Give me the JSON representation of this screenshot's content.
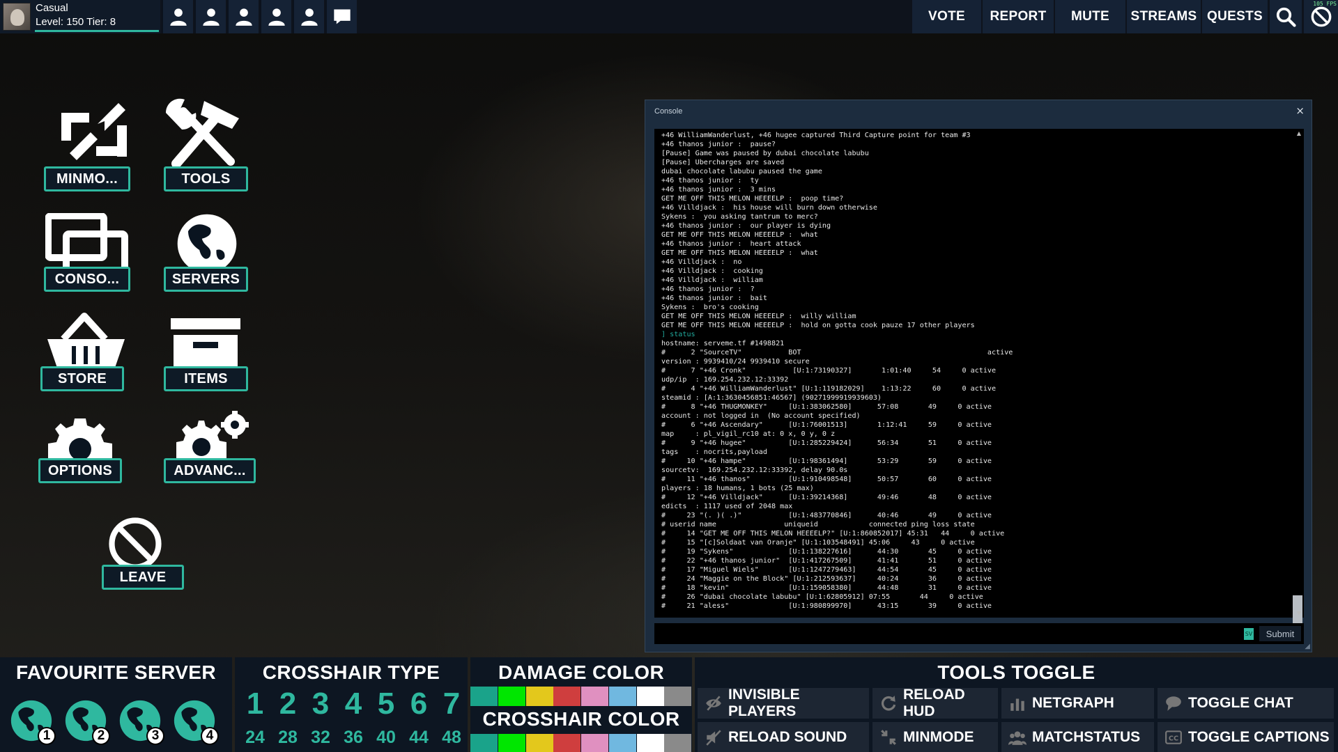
{
  "player": {
    "name": "Casual",
    "level_text": "Level: 150 Tier: 8"
  },
  "party_slots": [
    "person-icon",
    "person-icon",
    "person-icon",
    "person-icon",
    "person-icon",
    "chat-bubble-icon"
  ],
  "nav": {
    "vote": "VOTE",
    "report": "REPORT",
    "mute": "MUTE",
    "streams": "STREAMS",
    "quests": "QUESTS"
  },
  "fps": "105 FPS",
  "menu": {
    "minmode": "MINMO...",
    "tools": "TOOLS",
    "console": "CONSO...",
    "servers": "SERVERS",
    "store": "STORE",
    "items": "ITEMS",
    "options": "OPTIONS",
    "advanced": "ADVANC...",
    "leave": "LEAVE"
  },
  "console": {
    "title": "Console",
    "close": "×",
    "submit": "Submit",
    "sv_badge": "SV",
    "lines": [
      {
        "t": "+46 WilliamWanderlust, +46 hugee captured Third Capture point for team #3",
        "c": 0
      },
      {
        "t": "+46 thanos junior :  pause?",
        "c": 0
      },
      {
        "t": "[Pause] Game was paused by dubai chocolate labubu",
        "c": 0
      },
      {
        "t": "[Pause] Ubercharges are saved",
        "c": 0
      },
      {
        "t": "dubai chocolate labubu paused the game",
        "c": 0
      },
      {
        "t": "+46 thanos junior :  ty",
        "c": 0
      },
      {
        "t": "+46 thanos junior :  3 mins",
        "c": 0
      },
      {
        "t": "GET ME OFF THIS MELON HEEEELP :  poop time?",
        "c": 0
      },
      {
        "t": "+46 Villdjack :  his house will burn down otherwise",
        "c": 0
      },
      {
        "t": "Sykens :  you asking tantrum to merc?",
        "c": 0
      },
      {
        "t": "+46 thanos junior :  our player is dying",
        "c": 0
      },
      {
        "t": "GET ME OFF THIS MELON HEEEELP :  what",
        "c": 0
      },
      {
        "t": "+46 thanos junior :  heart attack",
        "c": 0
      },
      {
        "t": "GET ME OFF THIS MELON HEEEELP :  what",
        "c": 0
      },
      {
        "t": "+46 Villdjack :  no",
        "c": 0
      },
      {
        "t": "+46 Villdjack :  cooking",
        "c": 0
      },
      {
        "t": "+46 Villdjack :  william",
        "c": 0
      },
      {
        "t": "+46 thanos junior :  ?",
        "c": 0
      },
      {
        "t": "+46 thanos junior :  bait",
        "c": 0
      },
      {
        "t": "Sykens :  bro's cooking",
        "c": 0
      },
      {
        "t": "GET ME OFF THIS MELON HEEEELP :  willy william",
        "c": 0
      },
      {
        "t": "GET ME OFF THIS MELON HEEEELP :  hold on gotta cook pauze 17 other players",
        "c": 0
      },
      {
        "t": "] status",
        "c": 1
      },
      {
        "t": "hostname: serveme.tf #1498821",
        "c": 0
      },
      {
        "t": "#      2 \"SourceTV\"           BOT                                            active",
        "c": 0
      },
      {
        "t": "version : 9939410/24 9939410 secure",
        "c": 0
      },
      {
        "t": "#      7 \"+46 Cronk\"           [U:1:73190327]       1:01:40     54     0 active",
        "c": 0
      },
      {
        "t": "udp/ip  : 169.254.232.12:33392",
        "c": 0
      },
      {
        "t": "#      4 \"+46 WilliamWanderlust\" [U:1:119182029]    1:13:22     60     0 active",
        "c": 0
      },
      {
        "t": "steamid : [A:1:3630456851:46567] (90271999919939603)",
        "c": 0
      },
      {
        "t": "#      8 \"+46 THUGMONKEY\"     [U:1:383062580]      57:08       49     0 active",
        "c": 0
      },
      {
        "t": "account : not logged in  (No account specified)",
        "c": 0
      },
      {
        "t": "#      6 \"+46 Ascendary\"      [U:1:76001513]       1:12:41     59     0 active",
        "c": 0
      },
      {
        "t": "map     : pl_vigil_rc10 at: 0 x, 0 y, 0 z",
        "c": 0
      },
      {
        "t": "#      9 \"+46 hugee\"          [U:1:285229424]      56:34       51     0 active",
        "c": 0
      },
      {
        "t": "tags    : nocrits,payload",
        "c": 0
      },
      {
        "t": "#     10 \"+46 hampe\"          [U:1:98361494]       53:29       59     0 active",
        "c": 0
      },
      {
        "t": "sourcetv:  169.254.232.12:33392, delay 90.0s",
        "c": 0
      },
      {
        "t": "#     11 \"+46 thanos\"         [U:1:910498548]      50:57       60     0 active",
        "c": 0
      },
      {
        "t": "players : 18 humans, 1 bots (25 max)",
        "c": 0
      },
      {
        "t": "#     12 \"+46 Villdjack\"      [U:1:39214368]       49:46       48     0 active",
        "c": 0
      },
      {
        "t": "edicts  : 1117 used of 2048 max",
        "c": 0
      },
      {
        "t": "#     23 \"(. )( .)\"           [U:1:483770846]      40:46       49     0 active",
        "c": 0
      },
      {
        "t": "# userid name                uniqueid            connected ping loss state",
        "c": 0
      },
      {
        "t": "#     14 \"GET ME OFF THIS MELON HEEEELP?\" [U:1:860852017] 45:31   44     0 active",
        "c": 0
      },
      {
        "t": "#     15 \"[c]Soldaat van Oranje\" [U:1:103548491] 45:06     43     0 active",
        "c": 0
      },
      {
        "t": "#     19 \"Sykens\"             [U:1:138227616]      44:30       45     0 active",
        "c": 0
      },
      {
        "t": "#     22 \"+46 thanos junior\"  [U:1:417267509]      41:41       51     0 active",
        "c": 0
      },
      {
        "t": "#     17 \"Miguel Wiels\"       [U:1:1247279463]     44:54       45     0 active",
        "c": 0
      },
      {
        "t": "#     24 \"Maggie on the Block\" [U:1:212593637]     40:24       36     0 active",
        "c": 0
      },
      {
        "t": "#     18 \"kevin\"              [U:1:159058380]      44:48       31     0 active",
        "c": 0
      },
      {
        "t": "#     26 \"dubai chocolate labubu\" [U:1:62805912] 07:55       44     0 active",
        "c": 0
      },
      {
        "t": "#     21 \"aless\"              [U:1:980899970]      43:15       39     0 active",
        "c": 0
      }
    ]
  },
  "favourite_server": {
    "title": "FAVOURITE SERVER",
    "slots": [
      "1",
      "2",
      "3",
      "4"
    ]
  },
  "crosshair_type": {
    "title": "CROSSHAIR TYPE",
    "types": [
      "1",
      "2",
      "3",
      "4",
      "5",
      "6",
      "7"
    ],
    "sizes": [
      "24",
      "28",
      "32",
      "36",
      "40",
      "44",
      "48"
    ]
  },
  "damage_color": {
    "title": "DAMAGE COLOR",
    "colors": [
      "#1aa38a",
      "#00e600",
      "#e3c81c",
      "#cf3e3e",
      "#e090c0",
      "#70b8e0",
      "#ffffff",
      "#8a8a8a"
    ]
  },
  "crosshair_color": {
    "title": "CROSSHAIR COLOR",
    "colors": [
      "#1aa38a",
      "#00e600",
      "#e3c81c",
      "#cf3e3e",
      "#e090c0",
      "#70b8e0",
      "#ffffff",
      "#8a8a8a"
    ]
  },
  "tools_toggle": {
    "title": "TOOLS TOGGLE",
    "buttons": [
      {
        "label": "INVISIBLE PLAYERS",
        "icon": "invisible-icon"
      },
      {
        "label": "RELOAD HUD",
        "icon": "reload-icon"
      },
      {
        "label": "NETGRAPH",
        "icon": "bar-chart-icon"
      },
      {
        "label": "TOGGLE CHAT",
        "icon": "chat-icon"
      },
      {
        "label": "RELOAD SOUND",
        "icon": "sound-off-icon"
      },
      {
        "label": "MINMODE",
        "icon": "minmode-icon"
      },
      {
        "label": "MATCHSTATUS",
        "icon": "group-icon"
      },
      {
        "label": "TOGGLE CAPTIONS",
        "icon": "cc-icon"
      }
    ]
  },
  "colors": {
    "accent": "#2fb89f",
    "panel_bg": "#0d1622",
    "topbar_bg": "#152235"
  }
}
